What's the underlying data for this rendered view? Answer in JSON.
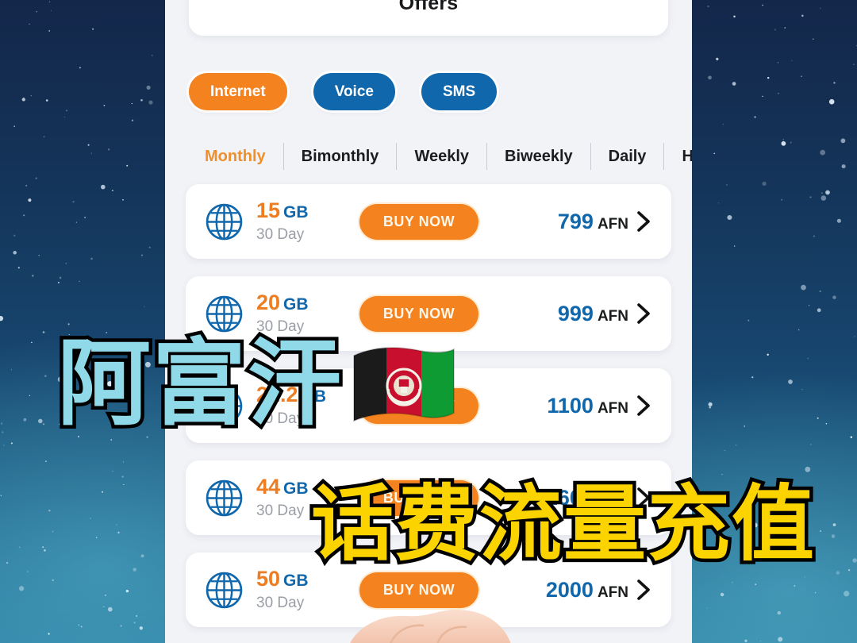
{
  "app": {
    "header_title": "Offers",
    "currency": "AFN",
    "validity_label": "30 Day",
    "data_unit": "GB",
    "buy_label": "BUY NOW"
  },
  "service_chips": [
    {
      "label": "Internet",
      "active": true,
      "color": "#f4821f"
    },
    {
      "label": "Voice",
      "active": false,
      "color": "#1167ab"
    },
    {
      "label": "SMS",
      "active": false,
      "color": "#1167ab"
    }
  ],
  "period_tabs": [
    {
      "label": "Monthly",
      "active": true
    },
    {
      "label": "Bimonthly",
      "active": false
    },
    {
      "label": "Weekly",
      "active": false
    },
    {
      "label": "Biweekly",
      "active": false
    },
    {
      "label": "Daily",
      "active": false
    },
    {
      "label": "Hourly",
      "active": false
    }
  ],
  "offers": [
    {
      "amount": "15",
      "unit": "GB",
      "validity": "30 Day",
      "buy": "BUY NOW",
      "price": "799",
      "currency": "AFN"
    },
    {
      "amount": "20",
      "unit": "GB",
      "validity": "30 Day",
      "buy": "BUY NOW",
      "price": "999",
      "currency": "AFN"
    },
    {
      "amount": "22.2",
      "unit": "GB",
      "validity": "30 Day",
      "buy": "BUY NOW",
      "price": "1100",
      "currency": "AFN"
    },
    {
      "amount": "44",
      "unit": "GB",
      "validity": "30 Day",
      "buy": "BUY NOW",
      "price": "1600",
      "currency": "AFN"
    },
    {
      "amount": "50",
      "unit": "GB",
      "validity": "30 Day",
      "buy": "BUY NOW",
      "price": "2000",
      "currency": "AFN"
    }
  ],
  "overlays": {
    "country_text": "阿富汗",
    "country_flag": "afghanistan-flag",
    "slogan_text": "话费流量充值"
  },
  "colors": {
    "accent_orange": "#f4821f",
    "accent_blue": "#1167ab",
    "overlay_cyan": "#8fd9e8",
    "overlay_yellow": "#fbd400",
    "screen_bg": "#f2f3f7",
    "card_bg": "#ffffff"
  }
}
